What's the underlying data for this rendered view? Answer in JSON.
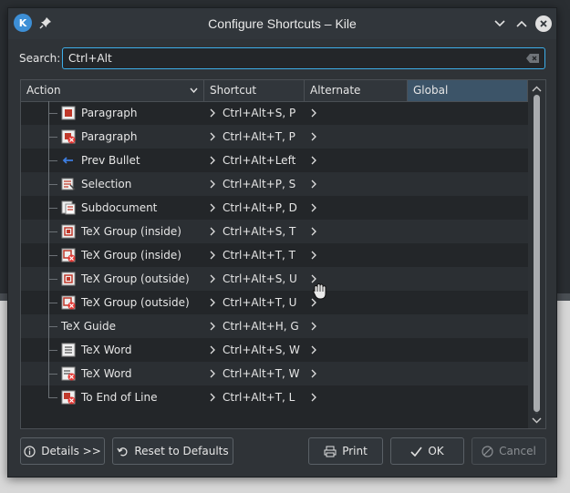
{
  "window": {
    "title": "Configure Shortcuts – Kile",
    "app_icon_text": "K"
  },
  "search": {
    "label": "Search:",
    "value": "Ctrl+Alt"
  },
  "table": {
    "columns": [
      "Action",
      "Shortcut",
      "Alternate",
      "Global"
    ],
    "rows": [
      {
        "action": "Paragraph",
        "shortcut": "Ctrl+Alt+S, P",
        "icon": "paragraph-icon"
      },
      {
        "action": "Paragraph",
        "shortcut": "Ctrl+Alt+T, P",
        "icon": "paragraph-delete-icon"
      },
      {
        "action": "Prev Bullet",
        "shortcut": "Ctrl+Alt+Left",
        "icon": "arrow-left-icon"
      },
      {
        "action": "Selection",
        "shortcut": "Ctrl+Alt+P, S",
        "icon": "selection-icon"
      },
      {
        "action": "Subdocument",
        "shortcut": "Ctrl+Alt+P, D",
        "icon": "subdocument-icon"
      },
      {
        "action": "TeX Group (inside)",
        "shortcut": "Ctrl+Alt+S, T",
        "icon": "texgroup-icon"
      },
      {
        "action": "TeX Group (inside)",
        "shortcut": "Ctrl+Alt+T, T",
        "icon": "texgroup-delete-icon"
      },
      {
        "action": "TeX Group (outside)",
        "shortcut": "Ctrl+Alt+S, U",
        "icon": "texgroup-icon"
      },
      {
        "action": "TeX Group (outside)",
        "shortcut": "Ctrl+Alt+T, U",
        "icon": "texgroup-delete-icon"
      },
      {
        "action": "TeX Guide",
        "shortcut": "Ctrl+Alt+H, G",
        "icon": ""
      },
      {
        "action": "TeX Word",
        "shortcut": "Ctrl+Alt+S, W",
        "icon": "word-icon"
      },
      {
        "action": "TeX Word",
        "shortcut": "Ctrl+Alt+T, W",
        "icon": "word-delete-icon"
      },
      {
        "action": "To End of Line",
        "shortcut": "Ctrl+Alt+T, L",
        "icon": "endofline-delete-icon"
      }
    ]
  },
  "buttons": {
    "details": "Details >>",
    "reset": "Reset to Defaults",
    "print": "Print",
    "ok": "OK",
    "cancel": "Cancel"
  },
  "colors": {
    "accent": "#3daee9",
    "selected_header": "#3c5468"
  }
}
